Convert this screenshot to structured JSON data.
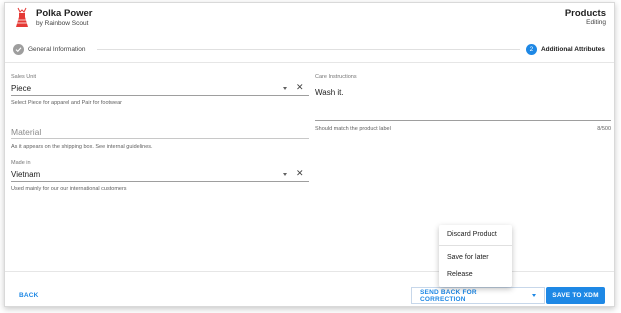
{
  "header": {
    "product_name": "Polka Power",
    "brand": "by Rainbow Scout",
    "page_title": "Products",
    "page_status": "Editing"
  },
  "stepper": {
    "steps": [
      {
        "label": "General Information",
        "state": "done",
        "number": ""
      },
      {
        "label": "Additional Attributes",
        "state": "active",
        "number": "2"
      }
    ]
  },
  "form": {
    "sales_unit": {
      "label": "Sales Unit",
      "value": "Piece",
      "hint": "Select Piece for apparel and Pair for footwear"
    },
    "material": {
      "placeholder": "Material",
      "hint": "As it appears on the shipping box. See internal guidelines."
    },
    "made_in": {
      "label": "Made in",
      "value": "Vietnam",
      "hint": "Used mainly for our our international customers"
    },
    "care_instructions": {
      "label": "Care Instructions",
      "value": "Wash it.",
      "hint": "Should match the product label",
      "counter": "8/500"
    }
  },
  "footer": {
    "back_label": "BACK",
    "send_back_label": "SEND BACK FOR CORRECTION",
    "primary_label": "SAVE TO XDM"
  },
  "menu": {
    "items": [
      "Discard Product",
      "Save for later",
      "Release"
    ]
  },
  "colors": {
    "accent": "#1e88e5",
    "logo": "#e53935"
  },
  "icons": {
    "logo": "dress-logo-icon",
    "step_done": "checkmark-icon",
    "clear": "close-icon",
    "dropdown": "caret-down-icon"
  }
}
